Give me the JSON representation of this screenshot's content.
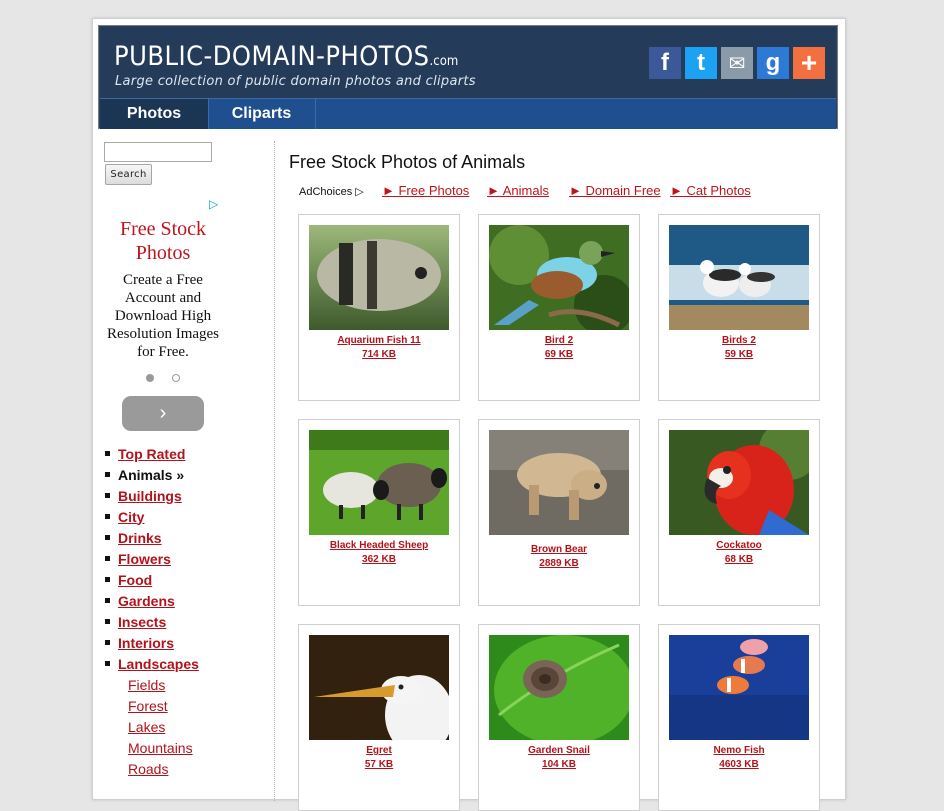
{
  "header": {
    "title": "PUBLIC-DOMAIN-PHOTOS",
    "title_suffix": ".com",
    "tagline": "Large collection of public domain photos and cliparts",
    "social": [
      {
        "name": "facebook-icon",
        "glyph": "f",
        "color": "#3b5998"
      },
      {
        "name": "twitter-icon",
        "glyph": "t",
        "color": "#1da1f2"
      },
      {
        "name": "email-icon",
        "glyph": "✉",
        "color": "#8a9aa8"
      },
      {
        "name": "google-plus-icon",
        "glyph": "g",
        "color": "#2d7ad6"
      },
      {
        "name": "share-plus-icon",
        "glyph": "+",
        "color": "#f26f3f"
      }
    ]
  },
  "nav": {
    "tabs": [
      {
        "label": "Photos",
        "active": true
      },
      {
        "label": "Cliparts",
        "active": false
      }
    ]
  },
  "search": {
    "value": "",
    "button_label": "Search"
  },
  "sidebar_ad": {
    "title": "Free Stock Photos",
    "body": "Create a Free Account and Download High Resolution Images for Free.",
    "next_glyph": "›"
  },
  "categories": [
    {
      "label": "Top Rated",
      "current": false
    },
    {
      "label": "Animals »",
      "current": true
    },
    {
      "label": "Buildings",
      "current": false
    },
    {
      "label": "City",
      "current": false
    },
    {
      "label": "Drinks",
      "current": false
    },
    {
      "label": "Flowers",
      "current": false
    },
    {
      "label": "Food",
      "current": false
    },
    {
      "label": "Gardens",
      "current": false
    },
    {
      "label": "Insects",
      "current": false
    },
    {
      "label": "Interiors",
      "current": false
    },
    {
      "label": "Landscapes",
      "current": false
    }
  ],
  "subcategories": [
    "Fields",
    "Forest",
    "Lakes",
    "Mountains",
    "Roads"
  ],
  "main": {
    "heading": "Free Stock Photos of Animals",
    "adchoices_label": "AdChoices",
    "ad_links": [
      "► Free Photos",
      "► Animals",
      "► Domain Free",
      "► Cat Photos"
    ]
  },
  "photos": [
    {
      "title": "Aquarium Fish 11",
      "size": "714 KB",
      "thumb": "fish"
    },
    {
      "title": "Bird 2",
      "size": "69 KB",
      "thumb": "bird"
    },
    {
      "title": "Birds 2",
      "size": "59 KB",
      "thumb": "gulls"
    },
    {
      "title": "Black Headed Sheep",
      "size": "362 KB",
      "thumb": "sheep"
    },
    {
      "title": "Brown Bear",
      "size": "2889 KB",
      "thumb": "bear"
    },
    {
      "title": "Cockatoo",
      "size": "68 KB",
      "thumb": "parrot"
    },
    {
      "title": "Egret",
      "size": "57 KB",
      "thumb": "egret"
    },
    {
      "title": "Garden Snail",
      "size": "104 KB",
      "thumb": "snail"
    },
    {
      "title": "Nemo Fish",
      "size": "4603 KB",
      "thumb": "nemo"
    }
  ]
}
